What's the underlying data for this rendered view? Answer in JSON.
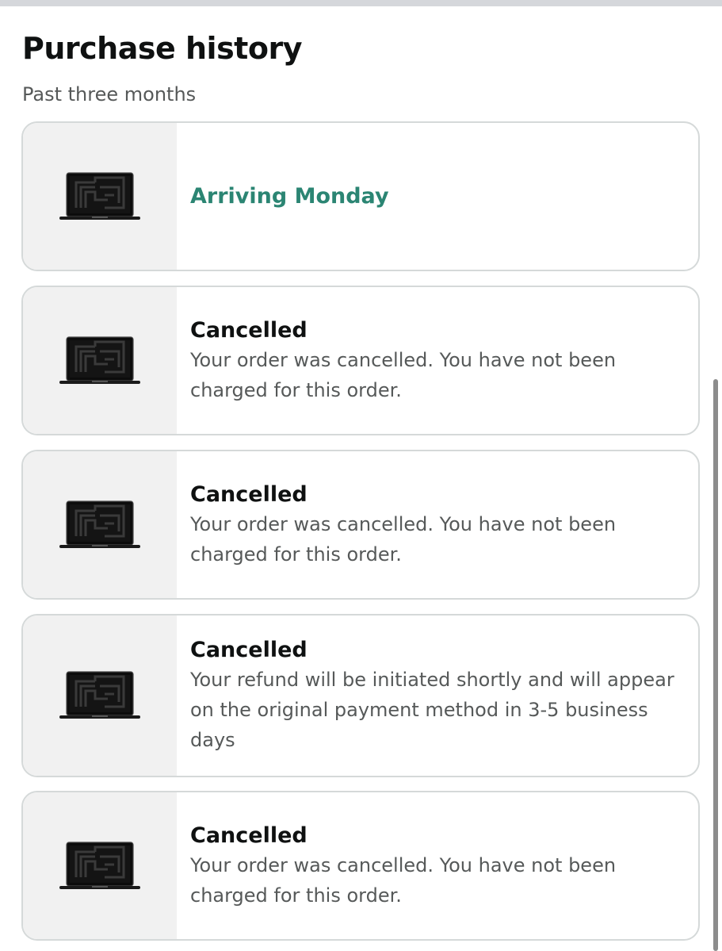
{
  "header": {
    "title": "Purchase history",
    "subtitle": "Past three months"
  },
  "orders": [
    {
      "status": "Arriving Monday",
      "description": "",
      "image": "laptop-icon"
    },
    {
      "status": "Cancelled",
      "description": "Your order was cancelled. You have not been charged for this order.",
      "image": "laptop-icon"
    },
    {
      "status": "Cancelled",
      "description": "Your order was cancelled. You have not been charged for this order.",
      "image": "laptop-icon"
    },
    {
      "status": "Cancelled",
      "description": "Your refund will be initiated shortly and will appear on the original payment method in 3-5 business days",
      "image": "laptop-icon"
    },
    {
      "status": "Cancelled",
      "description": "Your order was cancelled. You have not been charged for this order.",
      "image": "laptop-icon"
    }
  ],
  "colors": {
    "arriving": "#2b8573",
    "text": "#0f1111",
    "secondary": "#565959",
    "card_border": "#d5d9d9",
    "thumb_bg": "#f1f1f1"
  }
}
